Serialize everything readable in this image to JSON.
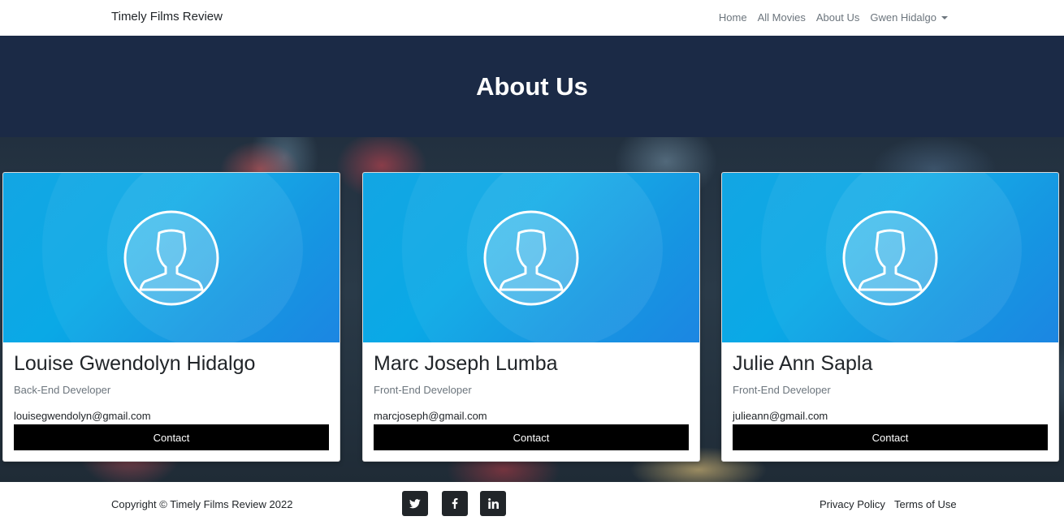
{
  "navbar": {
    "brand": "Timely Films Review",
    "links": [
      "Home",
      "All Movies",
      "About Us"
    ],
    "user_menu": "Gwen Hidalgo"
  },
  "hero": {
    "title": "About Us"
  },
  "team": [
    {
      "name": "Louise Gwendolyn Hidalgo",
      "role": "Back-End Developer",
      "email": "louisegwendolyn@gmail.com",
      "button": "Contact"
    },
    {
      "name": "Marc Joseph Lumba",
      "role": "Front-End Developer",
      "email": "marcjoseph@gmail.com",
      "button": "Contact"
    },
    {
      "name": "Julie Ann Sapla",
      "role": "Front-End Developer",
      "email": "julieann@gmail.com",
      "button": "Contact"
    }
  ],
  "footer": {
    "copyright": "Copyright © Timely Films Review 2022",
    "social": [
      "twitter-icon",
      "facebook-icon",
      "linkedin-icon"
    ],
    "links": [
      "Privacy Policy",
      "Terms of Use"
    ]
  },
  "colors": {
    "hero_bg": "#1b2a46",
    "card_header": "#0aa9e6",
    "button_bg": "#000000",
    "social_bg": "#212529"
  }
}
